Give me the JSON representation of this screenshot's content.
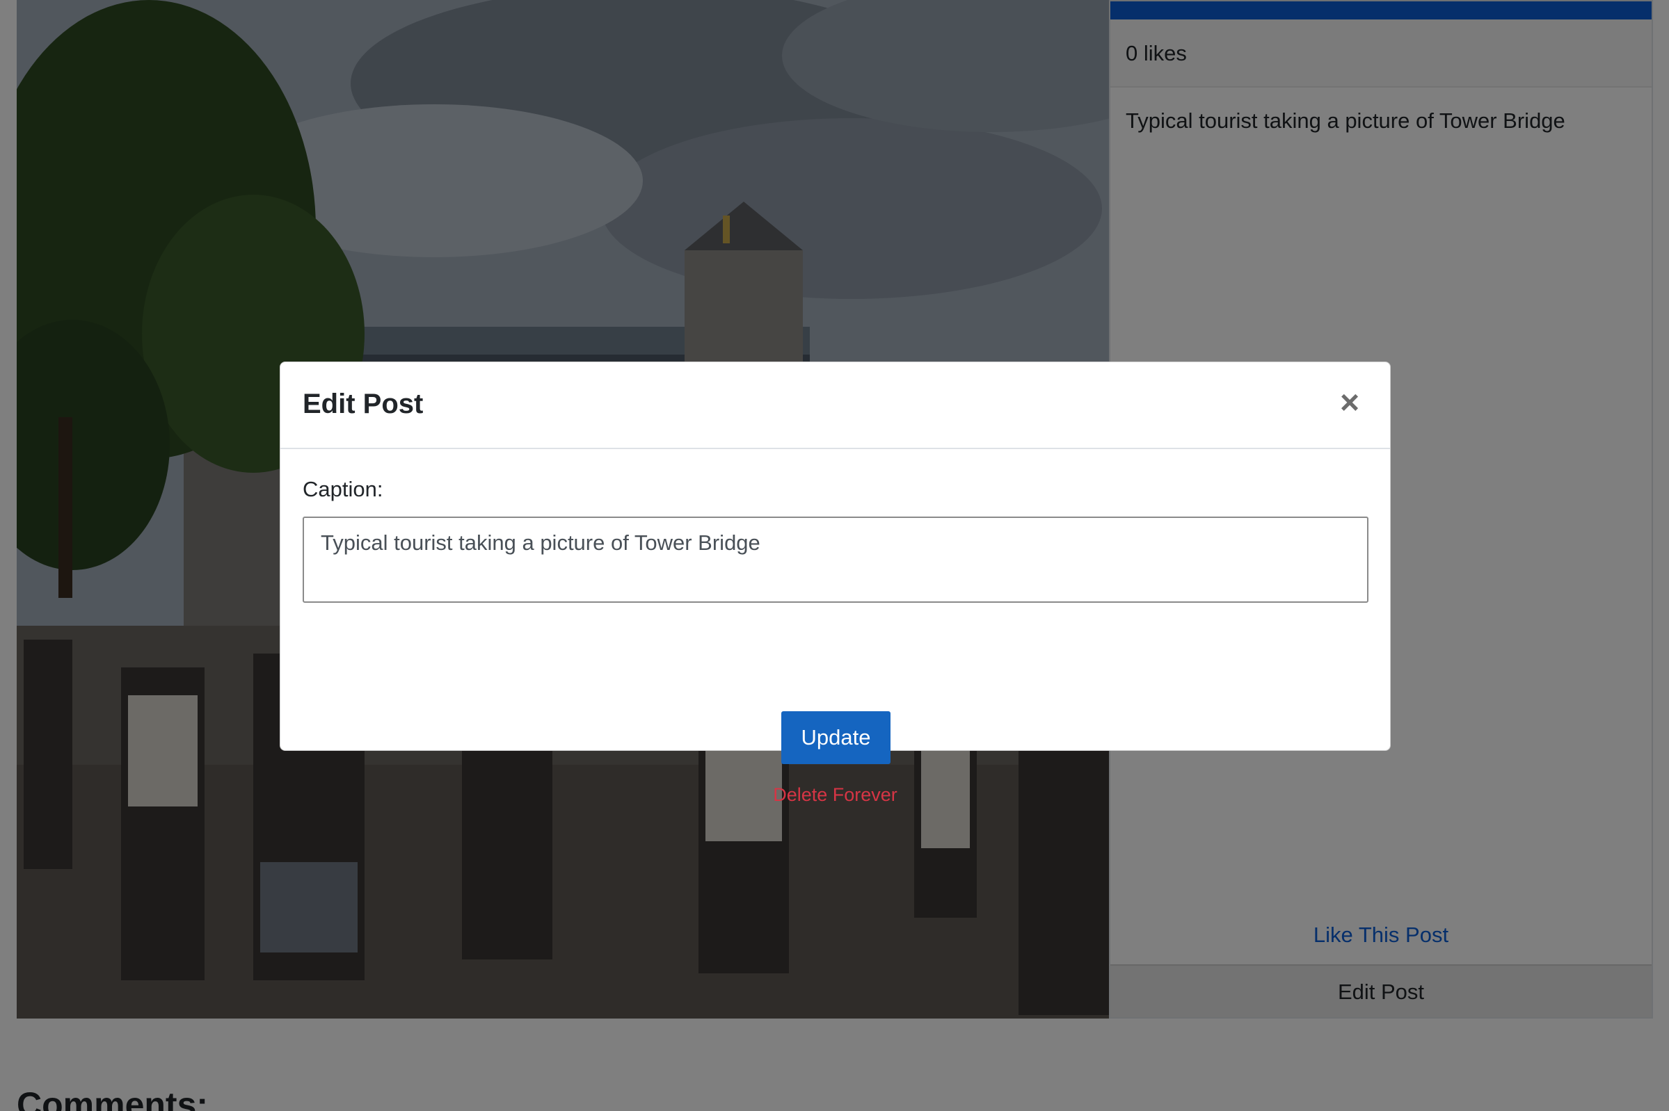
{
  "post": {
    "likes_text": "0 likes",
    "caption": "Typical tourist taking a picture of Tower Bridge",
    "like_link": "Like This Post",
    "edit_post_label": "Edit Post"
  },
  "comments": {
    "heading": "Comments:"
  },
  "modal": {
    "title": "Edit Post",
    "close_icon": "×",
    "caption_label": "Caption:",
    "caption_value": "Typical tourist taking a picture of Tower Bridge",
    "update_label": "Update",
    "delete_label": "Delete Forever"
  },
  "colors": {
    "accent": "#0d5fd6",
    "danger": "#d63545",
    "backdrop": "rgba(0,0,0,0.5)"
  }
}
